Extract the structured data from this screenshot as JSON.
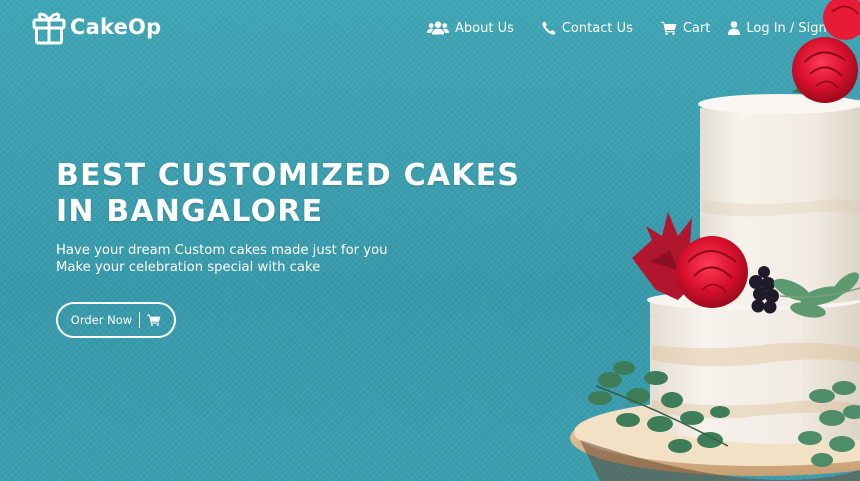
{
  "brand": {
    "name": "CakeOp",
    "icon": "gift-icon"
  },
  "nav": {
    "about": {
      "label": "About Us",
      "icon": "users-icon"
    },
    "contact": {
      "label": "Contact Us",
      "icon": "phone-icon"
    },
    "cart": {
      "label": "Cart",
      "icon": "cart-icon"
    },
    "login": {
      "label": "Log In / Sign Up",
      "icon": "user-icon"
    }
  },
  "hero": {
    "title_line1": "BEST CUSTOMIZED CAKES",
    "title_line2": "IN BANGALORE",
    "subtitle_line1": "Have your dream Custom cakes made just for you",
    "subtitle_line2": "Make your celebration special with cake",
    "cta": {
      "label": "Order Now",
      "icon": "cart-icon"
    }
  },
  "colors": {
    "background": "#3a9fb0",
    "text": "#ffffff",
    "cake_frosting": "#f3efe9",
    "rose": "#d4142e"
  }
}
